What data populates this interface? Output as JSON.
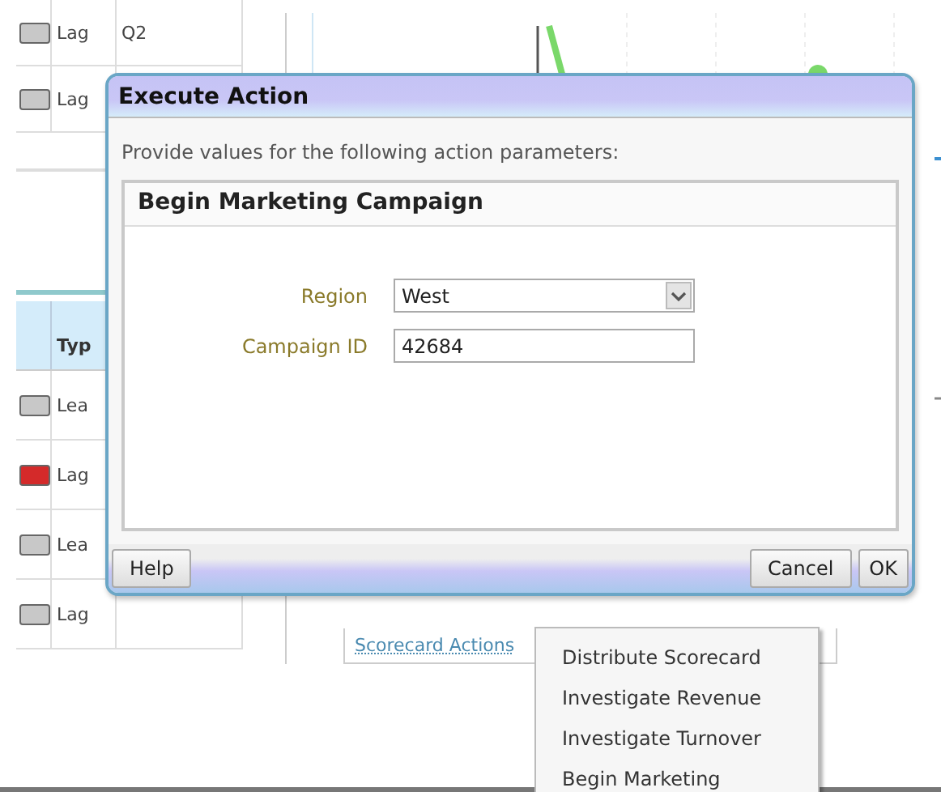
{
  "background_table": {
    "top_rows": [
      {
        "color": "#c8c8c8",
        "type": "Lag",
        "column_3": "Q2"
      },
      {
        "color": "#c8c8c8",
        "type": "Lag"
      }
    ],
    "header": {
      "column_2": "Typ"
    },
    "rows": [
      {
        "color": "#c8c8c8",
        "type": "Lea"
      },
      {
        "color": "#d42a2a",
        "type": "Lag"
      },
      {
        "color": "#c8c8c8",
        "type": "Lea"
      },
      {
        "color": "#c8c8c8",
        "type": "Lag"
      }
    ]
  },
  "dialog": {
    "title": "Execute Action",
    "instructions": "Provide values for the following action parameters:",
    "action": {
      "title": "Begin Marketing Campaign",
      "fields": [
        {
          "kind": "select",
          "label": "Region",
          "value": "West"
        },
        {
          "kind": "text",
          "label": "Campaign ID",
          "value": "42684"
        }
      ]
    },
    "buttons": [
      {
        "kind": "help",
        "label": "Help"
      },
      {
        "kind": "action",
        "label": "Cancel"
      },
      {
        "kind": "action",
        "label": "OK"
      }
    ]
  },
  "scorecard_actions": {
    "link": "Scorecard Actions",
    "menu": [
      {
        "label": "Distribute Scorecard"
      },
      {
        "label": "Investigate Revenue"
      },
      {
        "label": "Investigate Turnover"
      },
      {
        "label": "Begin Marketing"
      }
    ]
  }
}
